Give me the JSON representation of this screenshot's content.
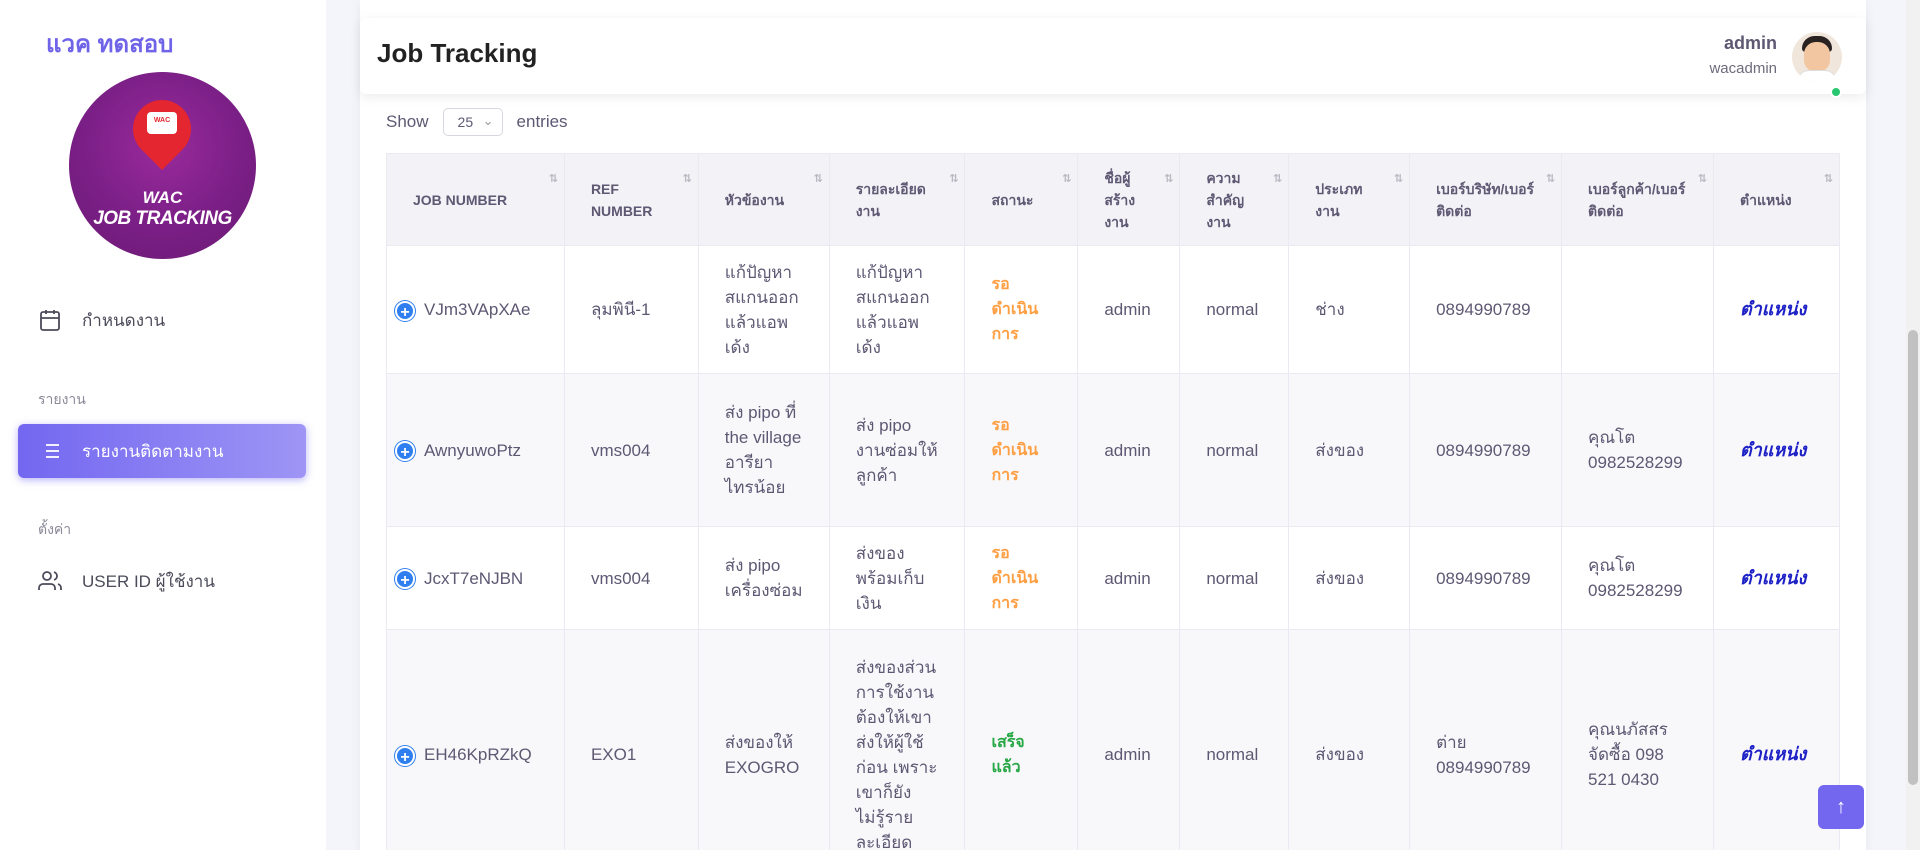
{
  "sidebar": {
    "brand": "แวค ทดสอบ",
    "logo_text_1": "WAC",
    "logo_text_2": "JOB TRACKING",
    "logo_badge": "WAC",
    "nav_schedule": "กำหนดงาน",
    "section_report": "รายงาน",
    "nav_report": "รายงานติดตามงาน",
    "section_settings": "ตั้งค่า",
    "nav_users": "USER ID ผู้ใช้งาน"
  },
  "header": {
    "title": "Job Tracking",
    "user_name": "admin",
    "user_sub": "wacadmin"
  },
  "entries": {
    "show": "Show",
    "value": "25",
    "label": "entries"
  },
  "table": {
    "columns": [
      "JOB NUMBER",
      "REF NUMBER",
      "หัวข้องาน",
      "รายละเอียดงาน",
      "สถานะ",
      "ชื่อผู้สร้างงาน",
      "ความสำคัญงาน",
      "ประเภทงาน",
      "เบอร์บริษัท/เบอร์ติดต่อ",
      "เบอร์ลูกค้า/เบอร์ติดต่อ",
      "ตำแหน่ง"
    ],
    "rows": [
      {
        "job": "VJm3VApXAe",
        "ref": "ลุมพินี-1",
        "topic": "แก้ปัญหาสแกนออกแล้วแอพเด้ง",
        "detail": "แก้ปัญหาสแกนออกแล้วแอพเด้ง",
        "status": "รอดำเนินการ",
        "creator": "admin",
        "priority": "normal",
        "type": "ช่าง",
        "company_phone": "0894990789",
        "customer_phone": "",
        "location": "ตำแหน่ง"
      },
      {
        "job": "AwnyuwoPtz",
        "ref": "vms004",
        "topic": "ส่ง pipo ที่ the village อารียา ไทรน้อย",
        "detail": "ส่ง pipo งานซ่อมให้ลูกค้า",
        "status": "รอดำเนินการ",
        "creator": "admin",
        "priority": "normal",
        "type": "ส่งของ",
        "company_phone": "0894990789",
        "customer_phone": "คุณโต 0982528299",
        "location": "ตำแหน่ง"
      },
      {
        "job": "JcxT7eNJBN",
        "ref": "vms004",
        "topic": "ส่ง pipo เครื่องซ่อม",
        "detail": "ส่งของพร้อมเก็บเงิน",
        "status": "รอดำเนินการ",
        "creator": "admin",
        "priority": "normal",
        "type": "ส่งของ",
        "company_phone": "0894990789",
        "customer_phone": "คุณโต 0982528299",
        "location": "ตำแหน่ง"
      },
      {
        "job": "EH46KpRZkQ",
        "ref": "EXO1",
        "topic": "ส่งของให้ EXOGRO",
        "detail": "ส่งของส่วนการใช้งานต้องให้เขาส่งให้ผู้ใช้ก่อน เพราะเขาก็ยังไม่รู้รายละเอียด",
        "status": "เสร็จแล้ว",
        "creator": "admin",
        "priority": "normal",
        "type": "ส่งของ",
        "company_phone": "ต่าย 0894990789",
        "customer_phone": "คุณนภัสสร จัดซื้อ 098 521 0430",
        "location": "ตำแหน่ง"
      }
    ]
  },
  "colors": {
    "accent": "#7367f0",
    "status_wait": "#ff9f43",
    "status_done": "#28a745",
    "location_link": "#1e22c6"
  }
}
